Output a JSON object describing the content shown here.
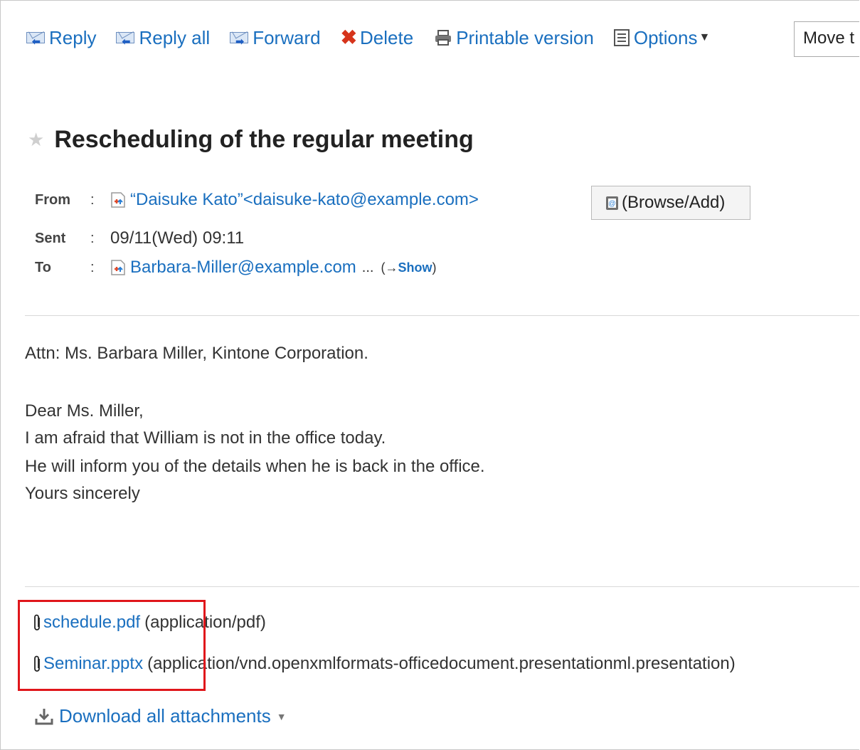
{
  "toolbar": {
    "reply": "Reply",
    "reply_all": "Reply all",
    "forward": "Forward",
    "delete": "Delete",
    "printable": "Printable version",
    "options": "Options",
    "move": "Move t"
  },
  "message": {
    "subject": "Rescheduling of the regular meeting",
    "from_label": "From",
    "from_value": "“Daisuke Kato”<daisuke-kato@example.com>",
    "browse_add": "(Browse/Add)",
    "sent_label": "Sent",
    "sent_value": "09/11(Wed) 09:11",
    "to_label": "To",
    "to_value": "Barbara-Miller@example.com",
    "to_more": "...",
    "show_prefix": "(→",
    "show_link": "Show",
    "show_suffix": ")",
    "colon": ":"
  },
  "body": {
    "lines": [
      "Attn: Ms. Barbara Miller, Kintone Corporation.",
      "Dear Ms. Miller,",
      "I am afraid that William is not in the office today.",
      "He will inform you of the details when he is back in the office.",
      "Yours sincerely"
    ]
  },
  "attachments": [
    {
      "name": "schedule.pdf",
      "type": "(application/pdf)"
    },
    {
      "name": "Seminar.pptx",
      "type": "(application/vnd.openxmlformats-officedocument.presentationml.presentation)"
    }
  ],
  "download_all": "Download all attachments",
  "colors": {
    "link": "#1a6fbf",
    "delete": "#d6341b",
    "highlight": "#e0161b"
  },
  "icons": [
    "reply-icon",
    "reply-all-icon",
    "forward-icon",
    "delete-icon",
    "print-icon",
    "options-icon",
    "star-icon",
    "address-icon",
    "addressbook-icon",
    "paperclip-icon",
    "download-icon"
  ]
}
